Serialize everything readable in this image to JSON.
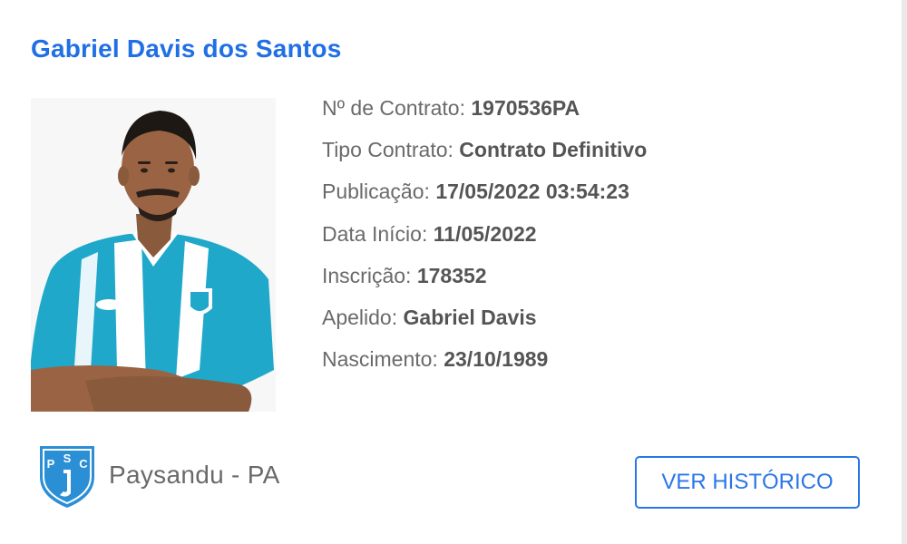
{
  "player": {
    "name": "Gabriel Davis dos Santos"
  },
  "details": [
    {
      "label": "Nº de Contrato:",
      "value": "1970536PA"
    },
    {
      "label": "Tipo Contrato:",
      "value": "Contrato Definitivo"
    },
    {
      "label": "Publicação:",
      "value": "17/05/2022 03:54:23"
    },
    {
      "label": "Data Início:",
      "value": "11/05/2022"
    },
    {
      "label": "Inscrição:",
      "value": "178352"
    },
    {
      "label": "Apelido:",
      "value": "Gabriel Davis"
    },
    {
      "label": "Nascimento:",
      "value": "23/10/1989"
    }
  ],
  "club": {
    "name": "Paysandu - PA",
    "crest_letters": [
      "P",
      "S",
      "C"
    ],
    "crest_icon": "paysandu-crest-icon"
  },
  "actions": {
    "history_label": "VER HISTÓRICO"
  },
  "colors": {
    "accent": "#1f6fe5",
    "button_border": "#2a76e8",
    "crest_blue": "#2b8fd6",
    "jersey_cyan": "#1fa8c9"
  }
}
